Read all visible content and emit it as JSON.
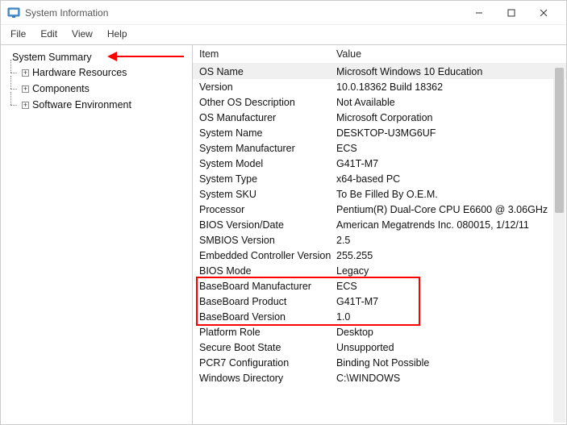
{
  "window": {
    "title": "System Information"
  },
  "menu": {
    "file": "File",
    "edit": "Edit",
    "view": "View",
    "help": "Help"
  },
  "tree": {
    "root": "System Summary",
    "children": [
      {
        "label": "Hardware Resources"
      },
      {
        "label": "Components"
      },
      {
        "label": "Software Environment"
      }
    ]
  },
  "table": {
    "headers": {
      "item": "Item",
      "value": "Value"
    },
    "rows": [
      {
        "item": "OS Name",
        "value": "Microsoft Windows 10 Education",
        "selected": true
      },
      {
        "item": "Version",
        "value": "10.0.18362 Build 18362"
      },
      {
        "item": "Other OS Description",
        "value": "Not Available"
      },
      {
        "item": "OS Manufacturer",
        "value": "Microsoft Corporation"
      },
      {
        "item": "System Name",
        "value": "DESKTOP-U3MG6UF"
      },
      {
        "item": "System Manufacturer",
        "value": "ECS"
      },
      {
        "item": "System Model",
        "value": "G41T-M7"
      },
      {
        "item": "System Type",
        "value": "x64-based PC"
      },
      {
        "item": "System SKU",
        "value": "To Be Filled By O.E.M."
      },
      {
        "item": "Processor",
        "value": "Pentium(R) Dual-Core  CPU      E6600  @ 3.06GHz"
      },
      {
        "item": "BIOS Version/Date",
        "value": "American Megatrends Inc. 080015, 1/12/11"
      },
      {
        "item": "SMBIOS Version",
        "value": "2.5"
      },
      {
        "item": "Embedded Controller Version",
        "value": "255.255"
      },
      {
        "item": "BIOS Mode",
        "value": "Legacy"
      },
      {
        "item": "BaseBoard Manufacturer",
        "value": "ECS",
        "highlighted": true
      },
      {
        "item": "BaseBoard Product",
        "value": "G41T-M7",
        "highlighted": true
      },
      {
        "item": "BaseBoard Version",
        "value": "1.0",
        "highlighted": true
      },
      {
        "item": "Platform Role",
        "value": "Desktop"
      },
      {
        "item": "Secure Boot State",
        "value": "Unsupported"
      },
      {
        "item": "PCR7 Configuration",
        "value": "Binding Not Possible"
      },
      {
        "item": "Windows Directory",
        "value": "C:\\WINDOWS"
      }
    ]
  }
}
